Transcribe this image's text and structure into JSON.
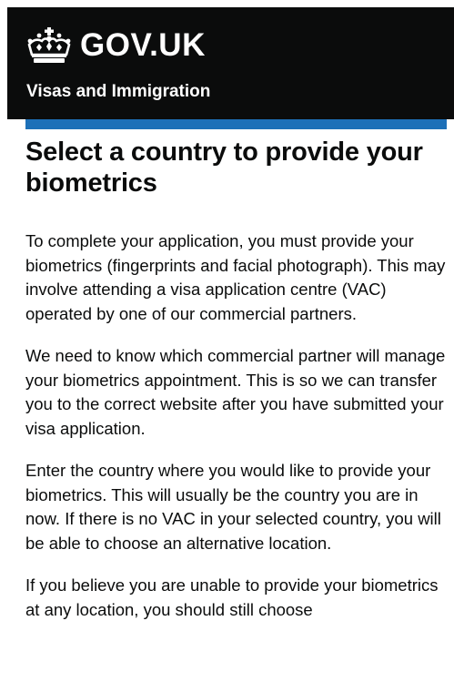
{
  "header": {
    "logo_text": "GOV.UK",
    "service_name": "Visas and Immigration"
  },
  "main": {
    "title": "Select a country to provide your biometrics",
    "paragraphs": [
      "To complete your application, you must provide your biometrics (fingerprints and facial photograph). This may involve attending a visa application centre (VAC) operated by one of our commercial partners.",
      "We need to know which commercial partner will manage your biometrics appointment. This is so we can transfer you to the correct website after you have submitted your visa application.",
      "Enter the country where you would like to provide your biometrics. This will usually be the country you are in now. If there is no VAC in your selected country, you will be able to choose an alternative location.",
      "If you believe you are unable to provide your biometrics at any location, you should still choose"
    ]
  },
  "colors": {
    "header_bg": "#0b0c0c",
    "accent_bar": "#1d70b8",
    "text": "#0b0c0c",
    "header_text": "#ffffff"
  },
  "icons": {
    "logo": "crown-icon"
  }
}
